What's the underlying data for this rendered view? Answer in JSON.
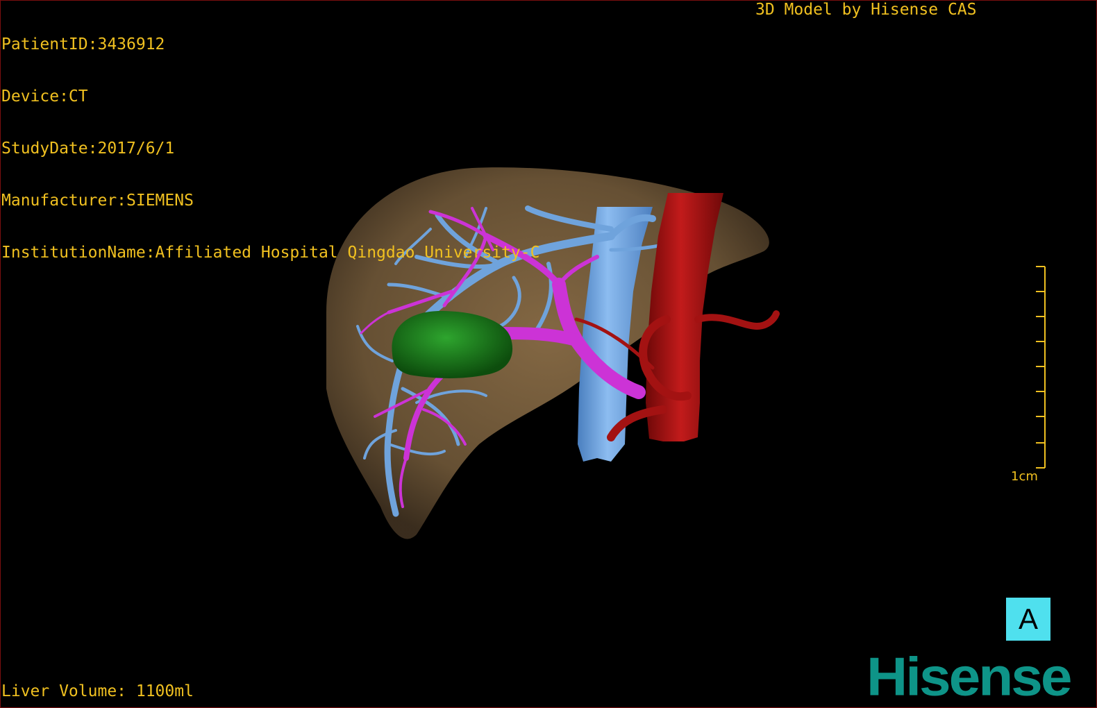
{
  "overlay": {
    "patient_id": "PatientID:3436912",
    "device": "Device:CT",
    "study_date": "StudyDate:2017/6/1",
    "manufacturer": "Manufacturer:SIEMENS",
    "institution": "InstitutionName:Affiliated Hospital Qingdao University-C",
    "model_credit": "3D Model by Hisense CAS",
    "liver_volume": "Liver Volume: 1100ml"
  },
  "scale_bar": {
    "label": "1cm"
  },
  "orientation_button": {
    "label": "A",
    "color": "#4fe0ee"
  },
  "logo": {
    "text": "Hisense",
    "color": "#0e9488"
  },
  "colors": {
    "text": "#f0c020",
    "liver": "#6b5436",
    "hepatic_vein": "#6fa3dc",
    "portal_vein": "#cc33d6",
    "tumor": "#1d7a1d",
    "aorta": "#a31212",
    "background": "#000000"
  }
}
